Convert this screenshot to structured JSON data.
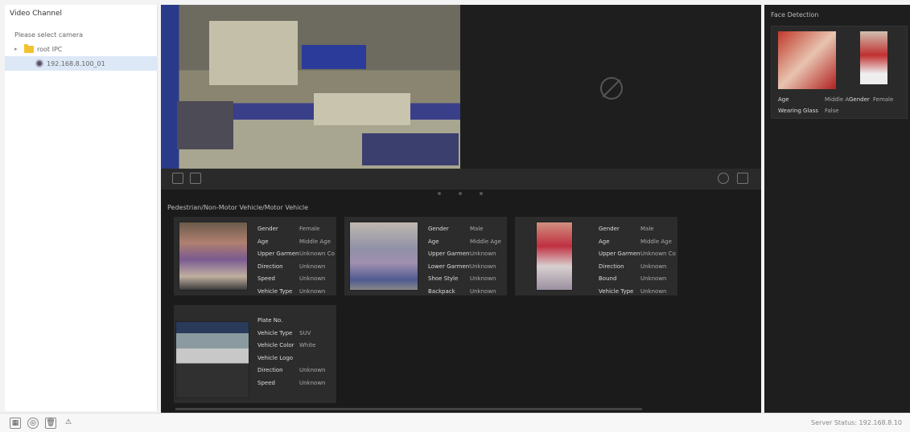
{
  "sidebar": {
    "title": "Video Channel",
    "tree": [
      {
        "label": "Please select camera",
        "type": "hint"
      },
      {
        "label": "root IPC",
        "type": "folder"
      },
      {
        "label": "192.168.8.100_01",
        "type": "camera",
        "selected": true
      }
    ]
  },
  "capture": {
    "title": "Pedestrian/Non-Motor Vehicle/Motor Vehicle",
    "cards": [
      {
        "rows": [
          [
            "Gender",
            "Female"
          ],
          [
            "Age",
            "Middle Age"
          ],
          [
            "Upper Garment",
            "Unknown Color"
          ],
          [
            "Direction",
            "Unknown"
          ],
          [
            "Speed",
            "Unknown"
          ],
          [
            "Vehicle Type",
            "Unknown"
          ]
        ]
      },
      {
        "rows": [
          [
            "Gender",
            "Male"
          ],
          [
            "Age",
            "Middle Age"
          ],
          [
            "Upper Garment",
            "Unknown"
          ],
          [
            "Lower Garment",
            "Unknown"
          ],
          [
            "Shoe Style",
            "Unknown"
          ],
          [
            "Backpack",
            "Unknown"
          ]
        ]
      },
      {
        "rows": [
          [
            "Gender",
            "Male"
          ],
          [
            "Age",
            "Middle Age"
          ],
          [
            "Upper Garment",
            "Unknown Color"
          ],
          [
            "Direction",
            "Unknown"
          ],
          [
            "Bound",
            "Unknown"
          ],
          [
            "Vehicle Type",
            "Unknown"
          ]
        ]
      },
      {
        "rows": [
          [
            "Plate No.",
            ""
          ],
          [
            "Vehicle Type",
            "SUV"
          ],
          [
            "Vehicle Color",
            "White"
          ],
          [
            "Vehicle Logo",
            ""
          ],
          [
            "Direction",
            "Unknown"
          ],
          [
            "Speed",
            "Unknown"
          ]
        ]
      }
    ]
  },
  "right": {
    "title": "Face Detection",
    "props": [
      [
        "Age",
        "Middle Age",
        "Gender",
        "Female"
      ],
      [
        "Wearing Glass",
        "False"
      ]
    ]
  },
  "status": {
    "text": "Server Status: 192.168.8.10"
  },
  "icons": {
    "toolbar_left": [
      "snapshot-icon",
      "record-icon"
    ],
    "toolbar_right": [
      "settings-icon",
      "fullscreen-icon"
    ],
    "statusbar": [
      "layout-icon",
      "target-icon",
      "delete-icon",
      "warning-icon"
    ]
  }
}
